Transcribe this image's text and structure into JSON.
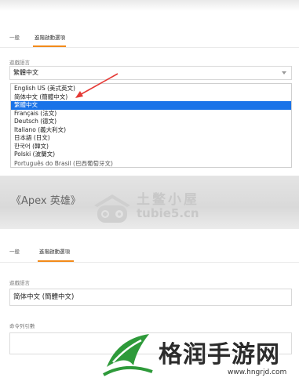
{
  "top_section": {
    "tabs": [
      {
        "label": "一般"
      },
      {
        "label": "進階啟動選項"
      }
    ],
    "language_label": "遊戲語言",
    "language_value": "繁體中文",
    "dropdown_options": [
      {
        "label": "English US (美式英文)"
      },
      {
        "label": "简体中文 (簡體中文)"
      },
      {
        "label": "繁體中文",
        "selected": true
      },
      {
        "label": "Français (法文)"
      },
      {
        "label": "Deutsch (德文)"
      },
      {
        "label": "Italiano (義大利文)"
      },
      {
        "label": "日本語 (日文)"
      },
      {
        "label": "한국어 (韓文)"
      },
      {
        "label": "Polski (波蘭文)"
      },
      {
        "label": "Português do Brasil (巴西葡萄牙文)"
      }
    ],
    "arrow_color": "#e53935"
  },
  "middle_band": {
    "game_title": "《Apex 英雄》",
    "watermark_name": "土鳖小屋",
    "watermark_url": "tubie5.cn"
  },
  "bottom_section": {
    "tabs": [
      {
        "label": "一般"
      },
      {
        "label": "進階啟動選項"
      }
    ],
    "language_label": "遊戲語言",
    "language_value": "简体中文 (簡體中文)",
    "command_line_label": "命令列引數",
    "command_line_value": "",
    "watermark_name": "格润手游网",
    "watermark_url": "www.hngrjd.com"
  },
  "colors": {
    "accent_tab": "#f28a1a",
    "selected_item": "#1a73e8",
    "watermark_green": "#2e9a3a"
  }
}
